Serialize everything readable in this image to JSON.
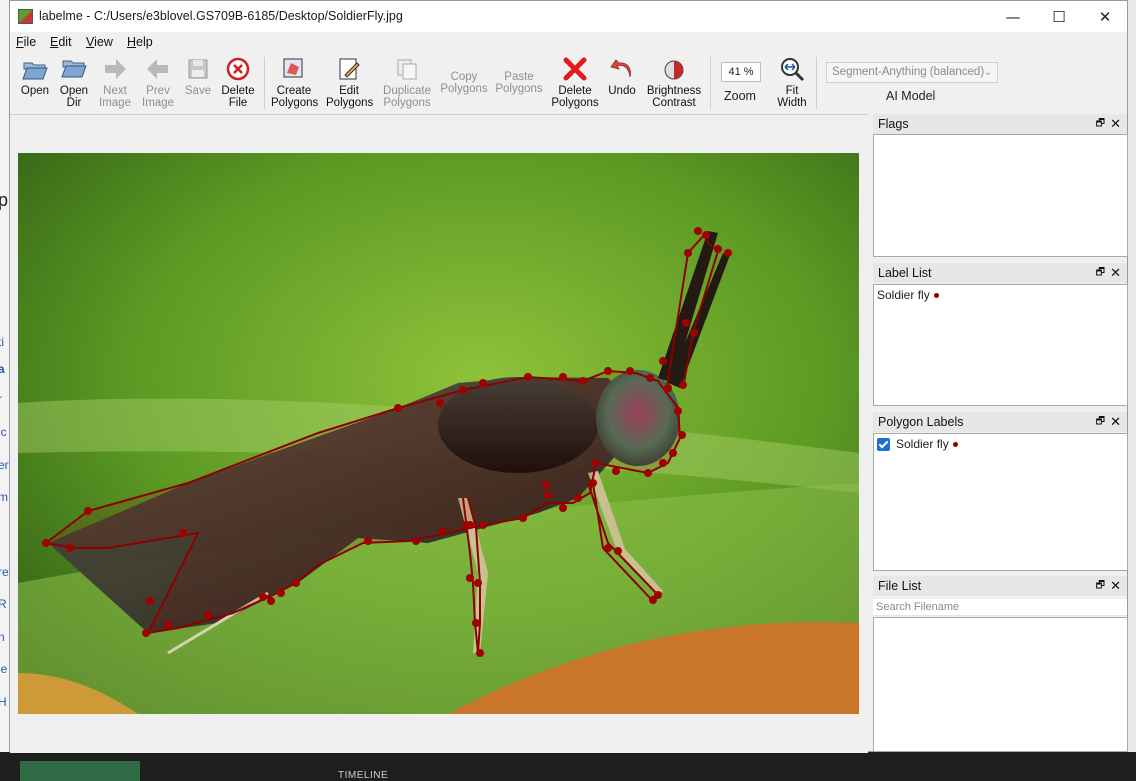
{
  "window": {
    "title": "labelme - C:/Users/e3blovel.GS709B-6185/Desktop/SoldierFly.jpg",
    "minimize": "—",
    "maximize": "☐",
    "close": "✕"
  },
  "menu": {
    "items": [
      "File",
      "Edit",
      "View",
      "Help"
    ]
  },
  "toolbar": {
    "open": "Open",
    "open_dir": "Open\nDir",
    "next_image": "Next\nImage",
    "prev_image": "Prev\nImage",
    "save": "Save",
    "delete_file": "Delete\nFile",
    "create_polygons": "Create\nPolygons",
    "edit_polygons": "Edit\nPolygons",
    "duplicate_polygons": "Duplicate\nPolygons",
    "copy_polygons": "Copy\nPolygons",
    "paste_polygons": "Paste\nPolygons",
    "delete_polygons": "Delete\nPolygons",
    "undo": "Undo",
    "brightness_contrast": "Brightness\nContrast",
    "zoom_value": "41 %",
    "zoom_label": "Zoom",
    "fit_width": "Fit\nWidth",
    "ai_model_value": "Segment-Anything (balanced)",
    "ai_model_label": "AI Model"
  },
  "docks": {
    "flags_title": "Flags",
    "label_list_title": "Label List",
    "label_list_items": [
      "Soldier fly"
    ],
    "polygon_labels_title": "Polygon Labels",
    "polygon_labels_items": [
      {
        "label": "Soldier fly",
        "checked": true
      }
    ],
    "file_list_title": "File List",
    "search_placeholder": "Search Filename",
    "float_icon": "🗗",
    "close_icon": "✕"
  },
  "annotation": {
    "label": "Soldier fly",
    "color": "#8b0000"
  },
  "background": {
    "timeline_text": "TIMELINE"
  }
}
